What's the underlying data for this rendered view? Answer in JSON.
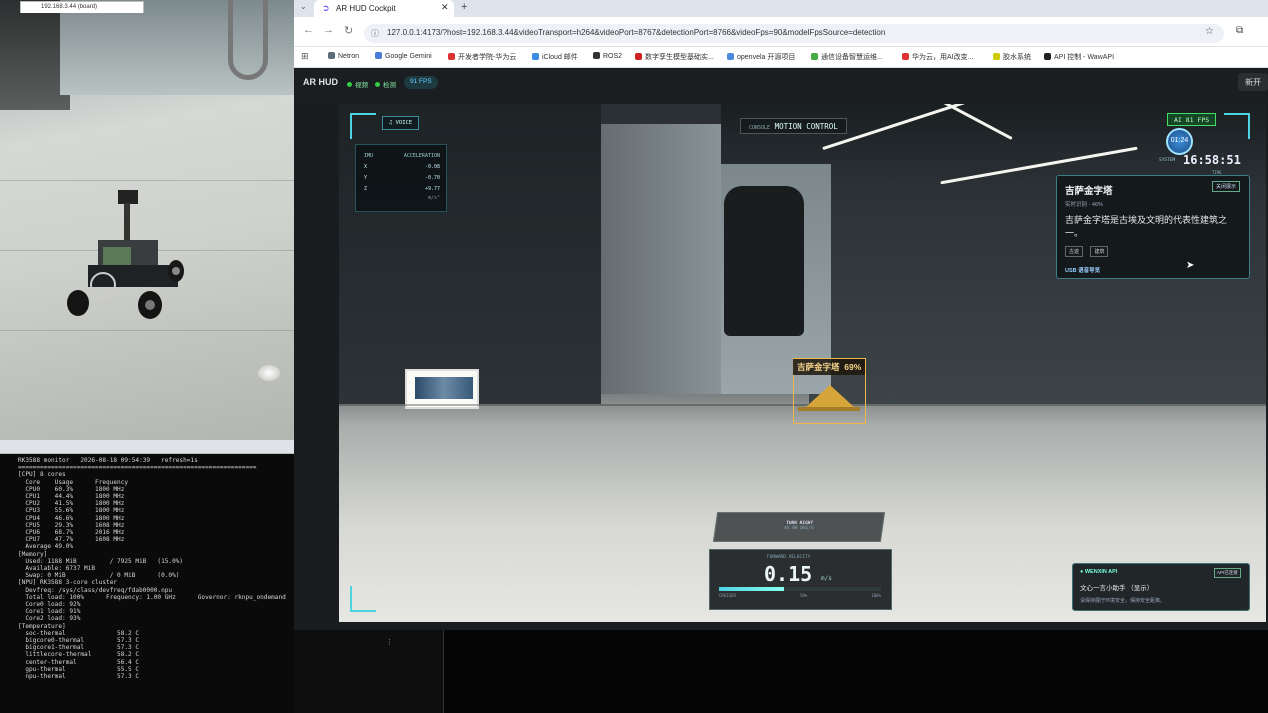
{
  "browser": {
    "tab_title": "AR HUD Cockpit",
    "url": "127.0.0.1:4173/?host=192.168.3.44&videoTransport=h264&videoPort=8767&detectionPort=8766&videoFps=90&modelFpsSource=detection",
    "bookmarks": [
      {
        "label": "Netron",
        "color": "#5b6b7a"
      },
      {
        "label": "Google Gemini",
        "color": "#4a7bd9"
      },
      {
        "label": "开发者学院-华为云",
        "color": "#d33"
      },
      {
        "label": "iCloud 邮件",
        "color": "#3a8de0"
      },
      {
        "label": "ROS2",
        "color": "#333"
      },
      {
        "label": "数字孪生模型基础实...",
        "color": "#c22"
      },
      {
        "label": "openvela 开源项目",
        "color": "#4b8be0"
      },
      {
        "label": "通信设备智慧运维...",
        "color": "#4a4"
      },
      {
        "label": "华为云，用AI改变...",
        "color": "#d33"
      },
      {
        "label": "胶水系统",
        "color": "#cc0"
      },
      {
        "label": "API 控制 - WawAPI",
        "color": "#222"
      }
    ]
  },
  "app": {
    "brand": "AR HUD",
    "status1": "视频",
    "status2": "检测",
    "fps": "91 FPS",
    "new_button": "新开"
  },
  "hud": {
    "voice": "VOICE",
    "motion_prefix": "CONSOLE",
    "motion": "MOTION CONTROL",
    "imu_title": "IMU",
    "imu_header": "ACCELERATION",
    "imu_rows": [
      {
        "axis": "X",
        "value": "-0.08"
      },
      {
        "axis": "Y",
        "value": "-0.70"
      },
      {
        "axis": "Z",
        "value": "+9.77"
      }
    ],
    "imu_unit": "m/s²",
    "ai_fps": "AI 81 FPS",
    "clock_dial": "01:24",
    "clock_sys": "SYSTEM",
    "clock_time": "16:58:51",
    "clock_label": "TIME",
    "card_title": "吉萨金字塔",
    "card_sub": "实时识别 · 46%",
    "card_desc": "吉萨金字塔是古埃及文明的代表性建筑之一。",
    "card_chips": [
      "古迹",
      "建筑"
    ],
    "card_usb": "USB 语音导览",
    "card_button": "关闭展示",
    "detection_label": "吉萨金字塔",
    "detection_conf": "69%",
    "turn_label": "TURN RIGHT",
    "turn_sub": "45.00 DEG/S",
    "speed_label": "FORWARD VELOCITY",
    "speed_value": "0.15",
    "speed_unit": "m/s",
    "speed_fraction": 0.4,
    "speed_foot_left": "CRUISER",
    "speed_foot_mid": "50%",
    "speed_foot_right": "100%",
    "wenxin_title": "WENXIN API",
    "wenxin_tag": "API已连接",
    "wenxin_name": "文心一言小助手 （显示）",
    "wenxin_msg": "请保持展厅环境安全，保持安全距离。"
  },
  "terminal": {
    "tab": "192.168.3.44 (board)",
    "lines": [
      "RK3588 monitor   2026-08-18 09:54:39   refresh=1s",
      "=================================================================",
      "",
      "[CPU] 8 cores",
      "  Core    Usage      Frequency",
      "  CPU0    60.3%      1800 MHz",
      "  CPU1    44.4%      1800 MHz",
      "  CPU2    41.5%      1800 MHz",
      "  CPU3    55.6%      1800 MHz",
      "  CPU4    46.6%      1800 MHz",
      "  CPU5    29.3%      1608 MHz",
      "  CPU6    68.7%      2016 MHz",
      "  CPU7    47.7%      1608 MHz",
      "  Average 49.0%",
      "",
      "[Memory]",
      "  Used: 1188 MiB         / 7925 MiB   (15.0%)",
      "  Available: 6737 MiB",
      "  Swap: 0 MiB            / 0 MiB      (0.0%)",
      "",
      "[NPU] RK3588 3-core cluster",
      "  Devfreq: /sys/class/devfreq/fdab0000.npu",
      "  Total load: 100%      Frequency: 1.00 GHz      Governor: rknpu_ondemand",
      "  Core0 load: 92%",
      "  Core1 load: 91%",
      "  Core2 load: 93%",
      "",
      "[Temperature]",
      "  soc-thermal              58.2 C",
      "  bigcore0-thermal         57.3 C",
      "  bigcore1-thermal         57.3 C",
      "  littlecore-thermal       58.2 C",
      "  center-thermal           56.4 C",
      "  gpu-thermal              55.5 C",
      "  npu-thermal              57.3 C"
    ]
  }
}
